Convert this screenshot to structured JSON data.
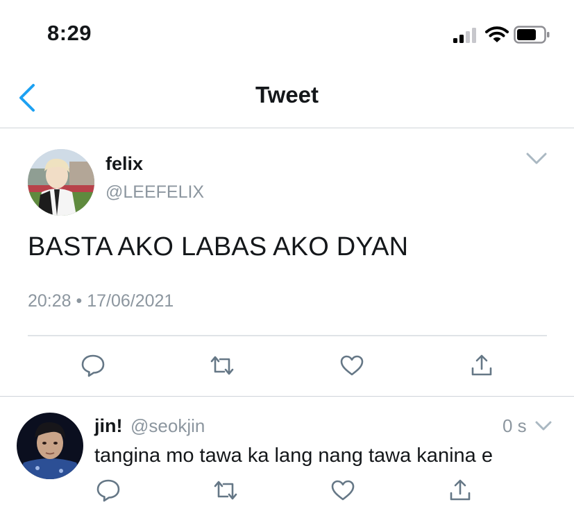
{
  "status_bar": {
    "time": "8:29"
  },
  "nav": {
    "title": "Tweet"
  },
  "tweet": {
    "author_name": "felix",
    "author_handle": "@LEEFELIX",
    "text": "BASTA AKO LABAS AKO DYAN",
    "timestamp": "20:28 • 17/06/2021"
  },
  "reply": {
    "author_name": "jin!",
    "author_handle": "@seokjin",
    "time": "0 s",
    "text": "tangina mo tawa ka lang nang tawa kanina e"
  },
  "colors": {
    "accent": "#1da1f2",
    "icon_gray": "#657786",
    "secondary_text": "#8c969f",
    "divider": "#cfd4d9"
  },
  "icons": [
    "back-icon",
    "chevron-down-icon",
    "reply-icon",
    "retweet-icon",
    "like-icon",
    "share-icon"
  ]
}
